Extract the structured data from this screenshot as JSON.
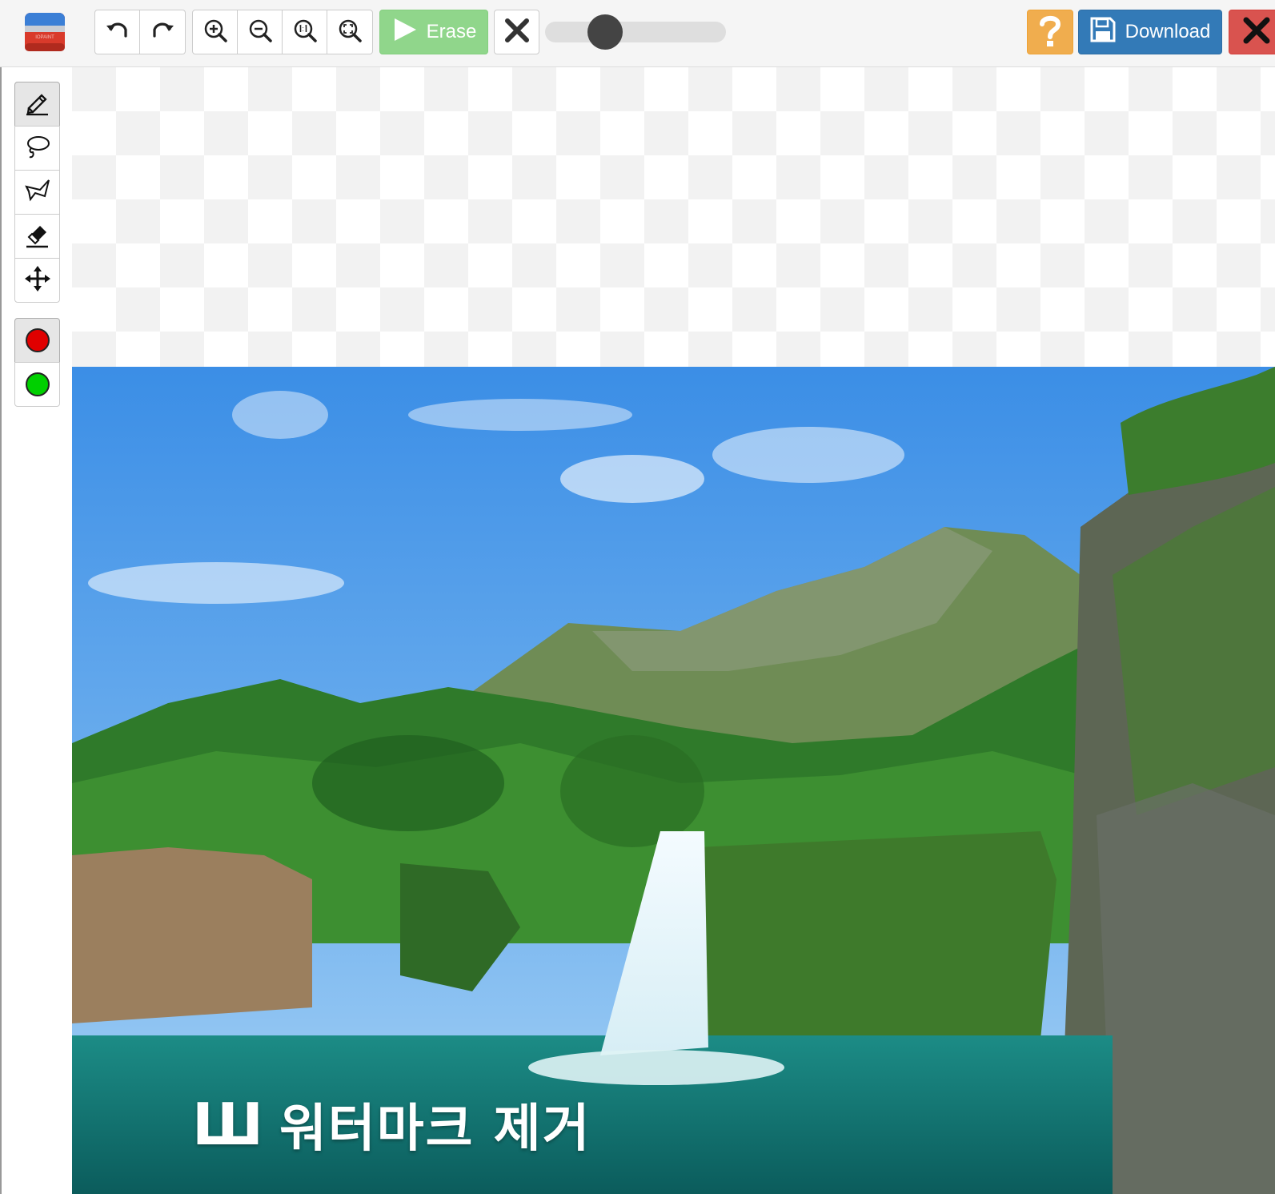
{
  "toolbar": {
    "erase_label": "Erase",
    "download_label": "Download",
    "brush_size": 0.33
  },
  "colors": {
    "red_marker": "#e00000",
    "green_marker": "#00d000",
    "erase_bg": "#90d68b",
    "download_bg": "#337ab7",
    "help_bg": "#f0ad4e",
    "close_bg": "#d9534f"
  },
  "icons": {
    "logo": "app-logo",
    "undo": "undo-icon",
    "redo": "redo-icon",
    "zoom_in": "zoom-in-icon",
    "zoom_out": "zoom-out-icon",
    "zoom_actual": "zoom-actual-size-icon",
    "zoom_fit": "zoom-fit-icon",
    "erase": "play-icon",
    "clear": "x-icon",
    "help": "question-icon",
    "download": "floppy-disk-icon",
    "close": "close-icon"
  },
  "tools": [
    {
      "name": "marker",
      "icon": "pencil-icon",
      "active": true
    },
    {
      "name": "lasso",
      "icon": "lasso-icon",
      "active": false
    },
    {
      "name": "polygon",
      "icon": "polygon-lasso-icon",
      "active": false
    },
    {
      "name": "eraser",
      "icon": "eraser-icon",
      "active": false
    },
    {
      "name": "move",
      "icon": "move-icon",
      "active": false
    }
  ],
  "image": {
    "watermark_text": "워터마크 제거"
  }
}
